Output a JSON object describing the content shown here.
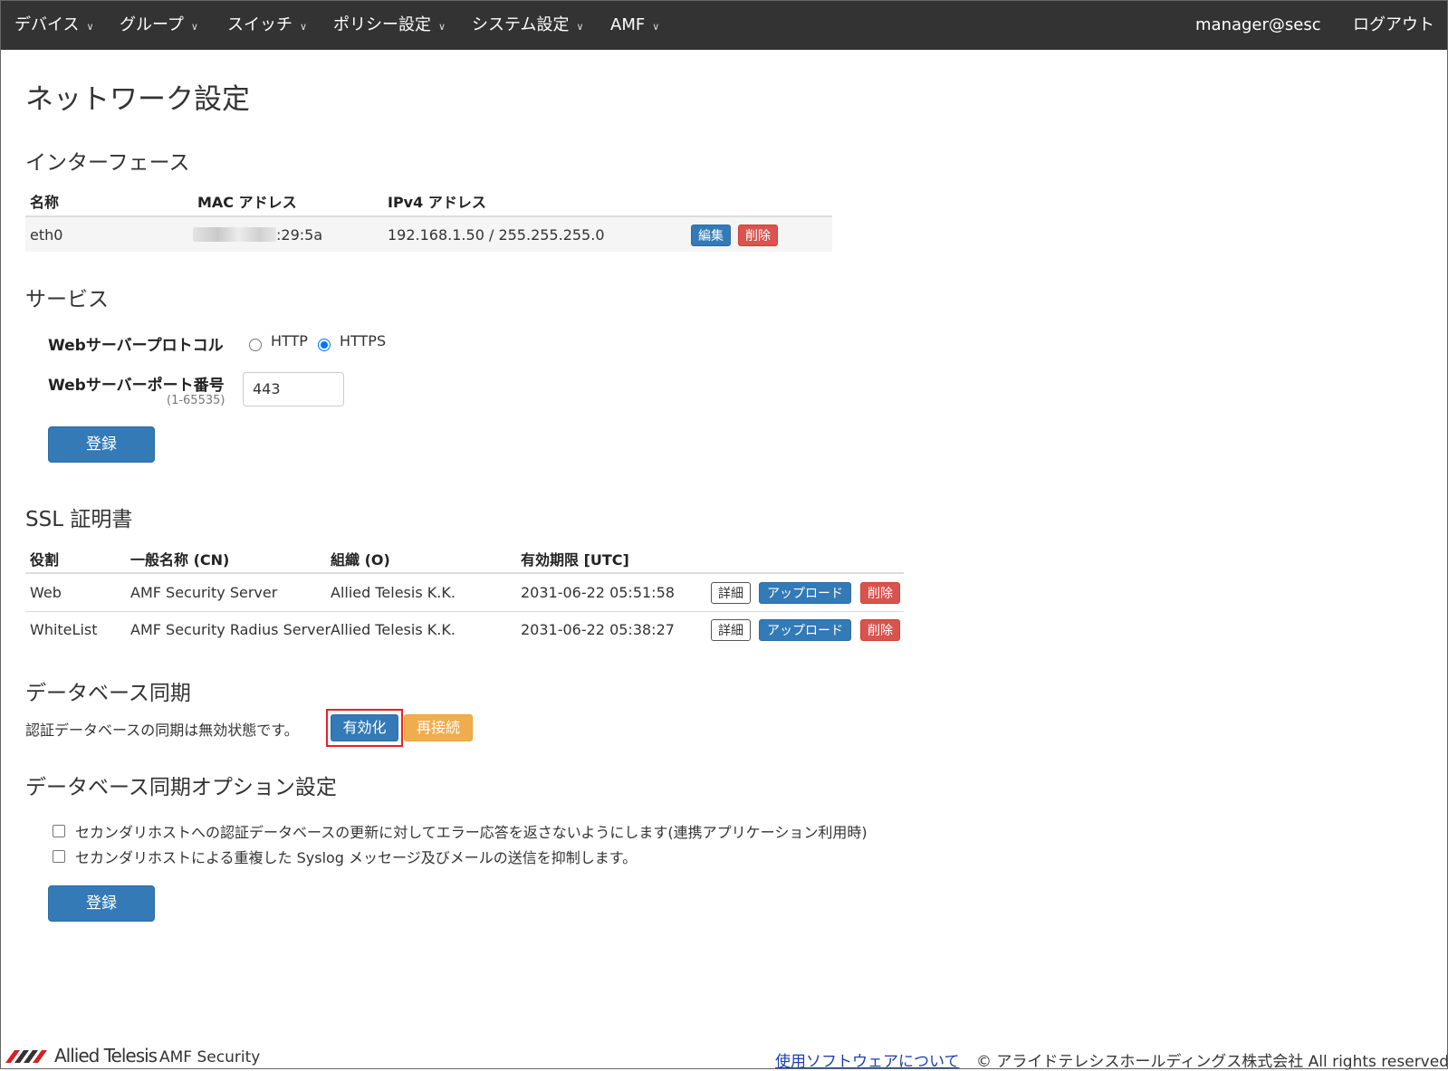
{
  "nav": {
    "items": [
      {
        "label": "デバイス"
      },
      {
        "label": "グループ"
      },
      {
        "label": "スイッチ"
      },
      {
        "label": "ポリシー設定"
      },
      {
        "label": "システム設定"
      },
      {
        "label": "AMF"
      }
    ],
    "user": "manager@sesc",
    "logout": "ログアウト"
  },
  "page_title": "ネットワーク設定",
  "interface": {
    "title": "インターフェース",
    "headers": [
      "名称",
      "MAC アドレス",
      "IPv4 アドレス"
    ],
    "row": {
      "name": "eth0",
      "mac_suffix": ":29:5a",
      "ipv4": "192.168.1.50 / 255.255.255.0"
    },
    "edit": "編集",
    "delete": "削除"
  },
  "service": {
    "title": "サービス",
    "protocol_label": "Webサーバープロトコル",
    "opt_http": "HTTP",
    "opt_https": "HTTPS",
    "selected": "HTTPS",
    "port_label": "Webサーバーポート番号",
    "port_range": "(1-65535)",
    "port_value": "443",
    "submit": "登録"
  },
  "ssl": {
    "title": "SSL 証明書",
    "headers": [
      "役割",
      "一般名称 (CN)",
      "組織 (O)",
      "有効期限 [UTC]"
    ],
    "rows": [
      {
        "role": "Web",
        "cn": "AMF Security Server",
        "org": "Allied Telesis K.K.",
        "expiry": "2031-06-22 05:51:58"
      },
      {
        "role": "WhiteList",
        "cn": "AMF Security Radius Server",
        "org": "Allied Telesis K.K.",
        "expiry": "2031-06-22 05:38:27"
      }
    ],
    "detail": "詳細",
    "upload": "アップロード",
    "delete": "削除"
  },
  "dbsync": {
    "title": "データベース同期",
    "status": "認証データベースの同期は無効状態です。",
    "enable": "有効化",
    "reconnect": "再接続"
  },
  "dbsync_opts": {
    "title": "データベース同期オプション設定",
    "opt1": "セカンダリホストへの認証データベースの更新に対してエラー応答を返さないようにします(連携アプリケーション利用時)",
    "opt2": "セカンダリホストによる重複した Syslog メッセージ及びメールの送信を抑制します。",
    "submit": "登録"
  },
  "footer": {
    "logo_text": "Allied Telesis",
    "product": "AMF Security",
    "link": "使用ソフトウェアについて",
    "copyright": "© アライドテレシスホールディングス株式会社 All rights reserved."
  },
  "colors": {
    "navbar": "#333333",
    "primary": "#337ab7",
    "danger": "#d9534f",
    "warning": "#f0ad4e",
    "highlight": "#e8202a"
  }
}
